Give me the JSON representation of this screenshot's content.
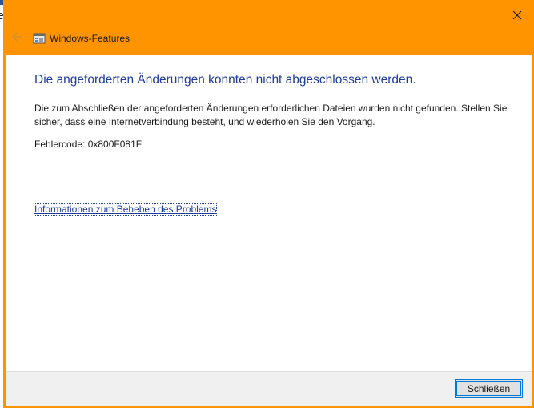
{
  "window": {
    "title": "Windows-Features",
    "accent_color": "#ff9400",
    "close_icon": "close-icon",
    "back_icon": "back-arrow-icon",
    "app_icon": "windows-features-icon"
  },
  "background": {
    "partial_char": "e"
  },
  "content": {
    "heading": "Die angeforderten Änderungen konnten nicht abgeschlossen werden.",
    "message": "Die zum Abschließen der angeforderten Änderungen erforderlichen Dateien wurden nicht gefunden. Stellen Sie sicher, dass eine Internetverbindung besteht, und wiederholen Sie den Vorgang.",
    "error_code": "Fehlercode: 0x800F081F",
    "help_link": "Informationen zum Beheben des Problems"
  },
  "footer": {
    "close_button_label": "Schließen"
  }
}
